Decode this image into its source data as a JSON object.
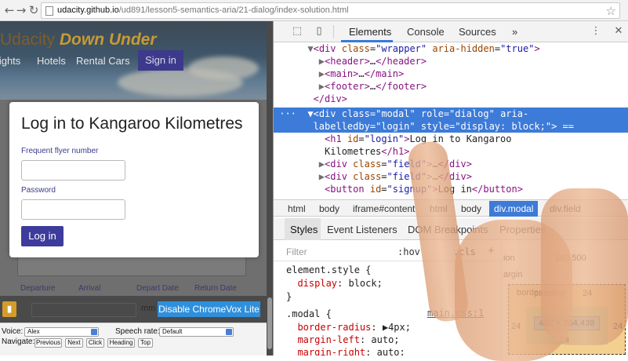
{
  "browser": {
    "url_host": "udacity.github.io",
    "url_path": "/ud891/lesson5-semantics-aria/21-dialog/index-solution.html"
  },
  "site": {
    "title_prefix": "Udacity",
    "title_accent": "Down Under",
    "nav": [
      "Flights",
      "Hotels",
      "Rental Cars"
    ],
    "sign_in": "Sign in",
    "bg_labels": [
      "Departure",
      "Arrival",
      "Depart Date",
      "Return Date"
    ]
  },
  "modal": {
    "title": "Log in to Kangaroo Kilometres",
    "field1_label": "Frequent flyer number",
    "field2_label": "Password",
    "button": "Log in"
  },
  "chromevox": {
    "disable_button": "Disable ChromeVox Lite",
    "partial_text": "mm",
    "voice_label": "Voice:",
    "voice_value": "Alex",
    "speech_rate_label": "Speech rate:",
    "speech_rate_value": "Default",
    "navigate_label": "Navigate:",
    "nav_buttons": [
      "Previous",
      "Next",
      "Click",
      "Heading",
      "Top"
    ]
  },
  "devtools": {
    "tabs": [
      "Elements",
      "Console",
      "Sources"
    ],
    "more": "»",
    "breadcrumbs": [
      "html",
      "body",
      "iframe#content",
      "html",
      "body",
      "div.modal",
      "div.field"
    ],
    "subtabs": [
      "Styles",
      "Event Listeners",
      "DOM Breakpoints",
      "Properties"
    ],
    "filter_placeholder": "Filter",
    "hov": ":hov",
    "cls": ".cls",
    "plus": "+",
    "styles": {
      "element_style": "element.style {",
      "display_prop": "display",
      "display_val": "block;",
      "close": "}",
      "modal_rule": ".modal {",
      "src": "main.css:1",
      "r1p": "border-radius",
      "r1v": "4px;",
      "r2p": "margin-left",
      "r2v": "auto;",
      "r3p": "margin-right",
      "r3v": "auto;"
    },
    "boxmodel": {
      "position_label": "ion",
      "position_value": "163.500",
      "margin_label": "argin",
      "margin_value": "-",
      "border_label": "border",
      "border_value": "-",
      "padding_label": "padding",
      "padding_value": "24",
      "content_size": "452 × 264.438",
      "left_value": "24",
      "right_value": "24",
      "bottom_value": "24"
    }
  }
}
